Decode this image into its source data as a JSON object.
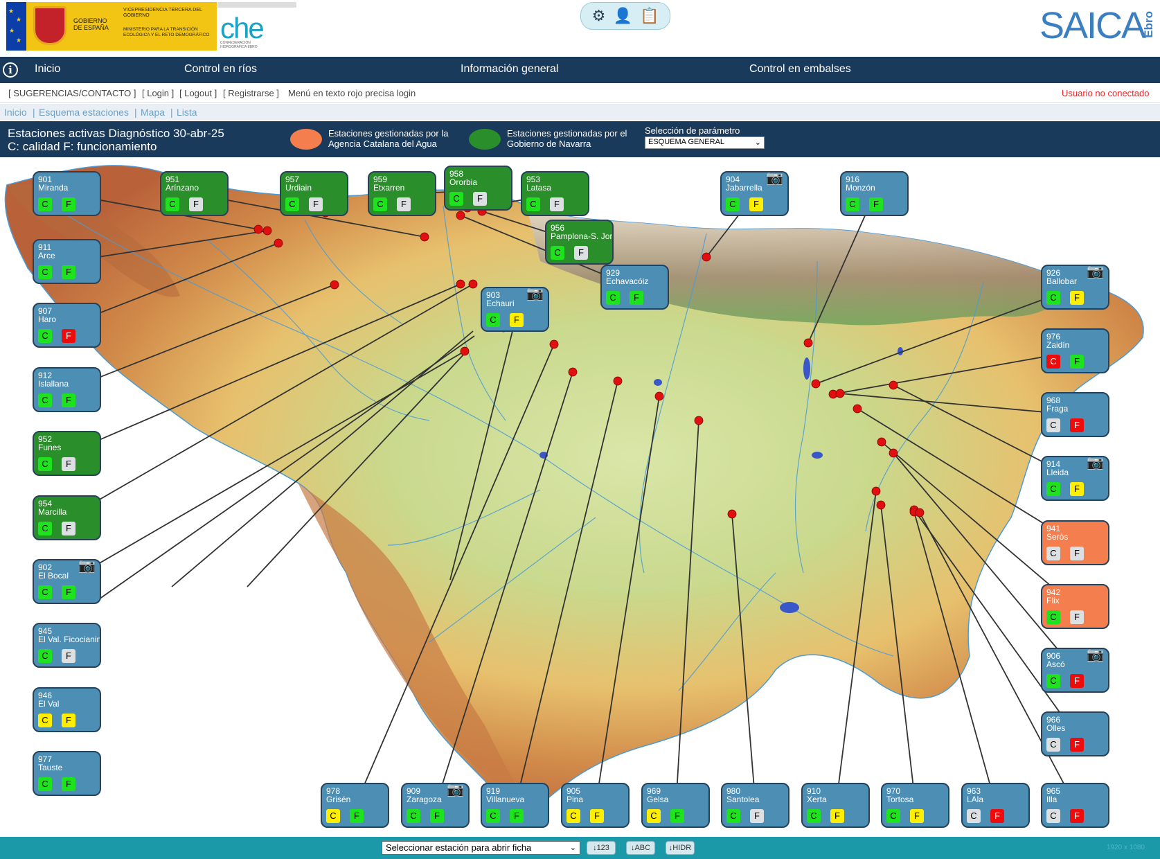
{
  "header": {
    "gov": {
      "line1": "GOBIERNO DE ESPAÑA",
      "line2": "VICEPRESIDENCIA TERCERA DEL GOBIERNO",
      "line3": "MINISTERIO PARA LA TRANSICIÓN ECOLÓGICA Y EL RETO DEMOGRÁFICO"
    },
    "che": {
      "word": "che",
      "sub": "CONFEDERACIÓN HIDROGRÁFICA EBRO"
    },
    "saica": "SAICA",
    "saica_sub": "Ebro",
    "icons": [
      "network-icon",
      "user-map-icon",
      "clipboard-icon"
    ]
  },
  "nav": {
    "info": "i",
    "items": [
      "Inicio",
      "Control en ríos",
      "Información general",
      "Control en embalses"
    ]
  },
  "login": {
    "suggest": "[ SUGERENCIAS/CONTACTO ]",
    "login": "[ Login ]",
    "logout": "[ Logout ]",
    "register": "[ Registrarse ]",
    "note": "Menú en texto rojo precisa login",
    "status": "Usuario no conectado"
  },
  "breadcrumb": [
    "Inicio",
    "|",
    "Esquema estaciones",
    "|",
    "Mapa",
    "|",
    "Lista"
  ],
  "legend": {
    "title1": "Estaciones activas  Diagnóstico 30-abr-25",
    "title2": "C: calidad F: funcionamiento",
    "catalan": "Estaciones gestionadas por la Agencia Catalana del Agua",
    "navarra": "Estaciones gestionadas por el Gobierno de Navarra",
    "param_label": "Selección de parámetro",
    "param_value": "ESQUEMA GENERAL",
    "colors": {
      "catalan": "#f47e4e",
      "navarra": "#2a8f2a",
      "default": "#4d8fb4"
    }
  },
  "stations": [
    {
      "id": "901",
      "name": "Miranda",
      "type": "blue",
      "c": "green",
      "f": "green"
    },
    {
      "id": "951",
      "name": "Arínzano",
      "type": "green",
      "c": "green",
      "f": "gray"
    },
    {
      "id": "957",
      "name": "Urdiain",
      "type": "green",
      "c": "green",
      "f": "gray"
    },
    {
      "id": "959",
      "name": "Etxarren",
      "type": "green",
      "c": "green",
      "f": "gray"
    },
    {
      "id": "958",
      "name": "Ororbia",
      "type": "green",
      "c": "green",
      "f": "gray"
    },
    {
      "id": "953",
      "name": "Latasa",
      "type": "green",
      "c": "green",
      "f": "gray"
    },
    {
      "id": "956",
      "name": "Pamplona-S. Jorg",
      "type": "green",
      "c": "green",
      "f": "gray"
    },
    {
      "id": "904",
      "name": "Jabarrella",
      "type": "blue",
      "c": "green",
      "f": "yellow",
      "cam": true
    },
    {
      "id": "916",
      "name": "Monzón",
      "type": "blue",
      "c": "green",
      "f": "green"
    },
    {
      "id": "911",
      "name": "Arce",
      "type": "blue",
      "c": "green",
      "f": "green"
    },
    {
      "id": "929",
      "name": "Echavacóiz",
      "type": "blue",
      "c": "green",
      "f": "green"
    },
    {
      "id": "903",
      "name": "Echauri",
      "type": "blue",
      "c": "green",
      "f": "yellow",
      "cam": true
    },
    {
      "id": "907",
      "name": "Haro",
      "type": "blue",
      "c": "green",
      "f": "red"
    },
    {
      "id": "926",
      "name": "Ballobar",
      "type": "blue",
      "c": "green",
      "f": "yellow",
      "cam": true
    },
    {
      "id": "912",
      "name": "Islallana",
      "type": "blue",
      "c": "green",
      "f": "green"
    },
    {
      "id": "976",
      "name": "Zaidín",
      "type": "blue",
      "c": "red",
      "f": "green"
    },
    {
      "id": "952",
      "name": "Funes",
      "type": "green",
      "c": "green",
      "f": "gray"
    },
    {
      "id": "968",
      "name": "Fraga",
      "type": "blue",
      "c": "gray",
      "f": "red"
    },
    {
      "id": "954",
      "name": "Marcilla",
      "type": "green",
      "c": "green",
      "f": "gray"
    },
    {
      "id": "914",
      "name": "Lleida",
      "type": "blue",
      "c": "green",
      "f": "yellow",
      "cam": true
    },
    {
      "id": "902",
      "name": "El Bocal",
      "type": "blue",
      "c": "green",
      "f": "green",
      "cam": true
    },
    {
      "id": "941",
      "name": "Seròs",
      "type": "orange",
      "c": "gray",
      "f": "gray"
    },
    {
      "id": "945",
      "name": "El Val. Ficocianina",
      "type": "blue",
      "c": "green",
      "f": "gray"
    },
    {
      "id": "942",
      "name": "Flix",
      "type": "orange",
      "c": "green",
      "f": "gray"
    },
    {
      "id": "946",
      "name": "El Val",
      "type": "blue",
      "c": "yellow",
      "f": "yellow"
    },
    {
      "id": "906",
      "name": "Ascó",
      "type": "blue",
      "c": "green",
      "f": "red",
      "cam": true
    },
    {
      "id": "977",
      "name": "Tauste",
      "type": "blue",
      "c": "green",
      "f": "green"
    },
    {
      "id": "966",
      "name": "Olles",
      "type": "blue",
      "c": "gray",
      "f": "red"
    },
    {
      "id": "978",
      "name": "Grisén",
      "type": "blue",
      "c": "yellow",
      "f": "green"
    },
    {
      "id": "909",
      "name": "Zaragoza",
      "type": "blue",
      "c": "green",
      "f": "green",
      "cam": true
    },
    {
      "id": "919",
      "name": "Villanueva",
      "type": "blue",
      "c": "green",
      "f": "green"
    },
    {
      "id": "905",
      "name": "Pina",
      "type": "blue",
      "c": "yellow",
      "f": "yellow"
    },
    {
      "id": "969",
      "name": "Gelsa",
      "type": "blue",
      "c": "yellow",
      "f": "green"
    },
    {
      "id": "980",
      "name": "Santolea",
      "type": "blue",
      "c": "green",
      "f": "gray"
    },
    {
      "id": "910",
      "name": "Xerta",
      "type": "blue",
      "c": "green",
      "f": "yellow"
    },
    {
      "id": "970",
      "name": "Tortosa",
      "type": "blue",
      "c": "green",
      "f": "yellow"
    },
    {
      "id": "963",
      "name": "LAla",
      "type": "blue",
      "c": "gray",
      "f": "red"
    },
    {
      "id": "965",
      "name": "Illa",
      "type": "blue",
      "c": "gray",
      "f": "red"
    }
  ],
  "bottom": {
    "select": "Seleccionar estación para abrir ficha",
    "btn1": "↓123",
    "btn2": "↓ABC",
    "btn3": "↓HIDR",
    "size": "1920 x 1080"
  }
}
